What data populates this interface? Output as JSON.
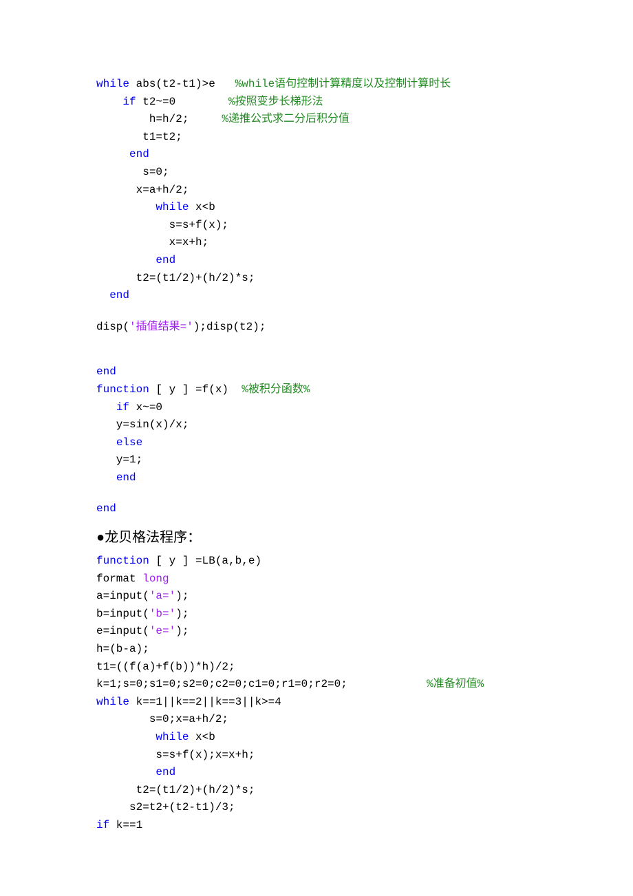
{
  "block1": {
    "lines": [
      [
        [
          "kw",
          "while"
        ],
        [
          "txt",
          " abs(t2-t1)>e   "
        ],
        [
          "com",
          "%while语句控制计算精度以及控制计算时长"
        ]
      ],
      [
        [
          "txt",
          "    "
        ],
        [
          "kw",
          "if"
        ],
        [
          "txt",
          " t2~=0        "
        ],
        [
          "com",
          "%按照变步长梯形法"
        ]
      ],
      [
        [
          "txt",
          "        h=h/2;     "
        ],
        [
          "com",
          "%递推公式求二分后积分值"
        ]
      ],
      [
        [
          "txt",
          "       t1=t2;"
        ]
      ],
      [
        [
          "txt",
          "     "
        ],
        [
          "kw",
          "end"
        ]
      ],
      [
        [
          "txt",
          "       s=0;"
        ]
      ],
      [
        [
          "txt",
          "      x=a+h/2;"
        ]
      ],
      [
        [
          "txt",
          "         "
        ],
        [
          "kw",
          "while"
        ],
        [
          "txt",
          " x<b"
        ]
      ],
      [
        [
          "txt",
          "           s=s+f(x);"
        ]
      ],
      [
        [
          "txt",
          "           x=x+h;"
        ]
      ],
      [
        [
          "txt",
          "         "
        ],
        [
          "kw",
          "end"
        ]
      ],
      [
        [
          "txt",
          "      t2=(t1/2)+(h/2)*s;"
        ]
      ],
      [
        [
          "txt",
          "  "
        ],
        [
          "kw",
          "end"
        ]
      ]
    ]
  },
  "disp_line": [
    [
      "txt",
      "disp("
    ],
    [
      "str",
      "'插值结果='"
    ],
    [
      "txt",
      ");disp(t2);"
    ]
  ],
  "block2": {
    "lines": [
      [
        [
          "kw",
          "end"
        ]
      ],
      [
        [
          "kw",
          "function"
        ],
        [
          "txt",
          " [ y ] =f(x)  "
        ],
        [
          "com",
          "%被积分函数%"
        ]
      ],
      [
        [
          "txt",
          "   "
        ],
        [
          "kw",
          "if"
        ],
        [
          "txt",
          " x~=0"
        ]
      ],
      [
        [
          "txt",
          "   y=sin(x)/x;"
        ]
      ],
      [
        [
          "txt",
          "   "
        ],
        [
          "kw",
          "else"
        ]
      ],
      [
        [
          "txt",
          "   y=1;"
        ]
      ],
      [
        [
          "txt",
          "   "
        ],
        [
          "kw",
          "end"
        ]
      ]
    ]
  },
  "end_line": [
    [
      "kw",
      "end"
    ]
  ],
  "heading": "●龙贝格法程序：",
  "block3": {
    "lines": [
      [
        [
          "kw",
          "function"
        ],
        [
          "txt",
          " [ y ] =LB(a,b,e)"
        ]
      ],
      [
        [
          "txt",
          "format "
        ],
        [
          "str",
          "long"
        ]
      ],
      [
        [
          "txt",
          "a=input("
        ],
        [
          "str",
          "'a='"
        ],
        [
          "txt",
          ");"
        ]
      ],
      [
        [
          "txt",
          "b=input("
        ],
        [
          "str",
          "'b='"
        ],
        [
          "txt",
          ");"
        ]
      ],
      [
        [
          "txt",
          "e=input("
        ],
        [
          "str",
          "'e='"
        ],
        [
          "txt",
          ");"
        ]
      ],
      [
        [
          "txt",
          "h=(b-a);"
        ]
      ],
      [
        [
          "txt",
          "t1=((f(a)+f(b))*h)/2;"
        ]
      ],
      [
        [
          "txt",
          "k=1;s=0;s1=0;s2=0;c2=0;c1=0;r1=0;r2=0;            "
        ],
        [
          "com",
          "%准备初值%"
        ]
      ],
      [
        [
          "kw",
          "while"
        ],
        [
          "txt",
          " k==1||k==2||k==3||k>=4"
        ]
      ],
      [
        [
          "txt",
          "        s=0;x=a+h/2;"
        ]
      ],
      [
        [
          "txt",
          "         "
        ],
        [
          "kw",
          "while"
        ],
        [
          "txt",
          " x<b"
        ]
      ],
      [
        [
          "txt",
          "         s=s+f(x);x=x+h;"
        ]
      ],
      [
        [
          "txt",
          "         "
        ],
        [
          "kw",
          "end"
        ]
      ],
      [
        [
          "txt",
          "      t2=(t1/2)+(h/2)*s;"
        ]
      ],
      [
        [
          "txt",
          "     s2=t2+(t2-t1)/3;"
        ]
      ],
      [
        [
          "kw",
          "if"
        ],
        [
          "txt",
          " k==1"
        ]
      ]
    ]
  }
}
